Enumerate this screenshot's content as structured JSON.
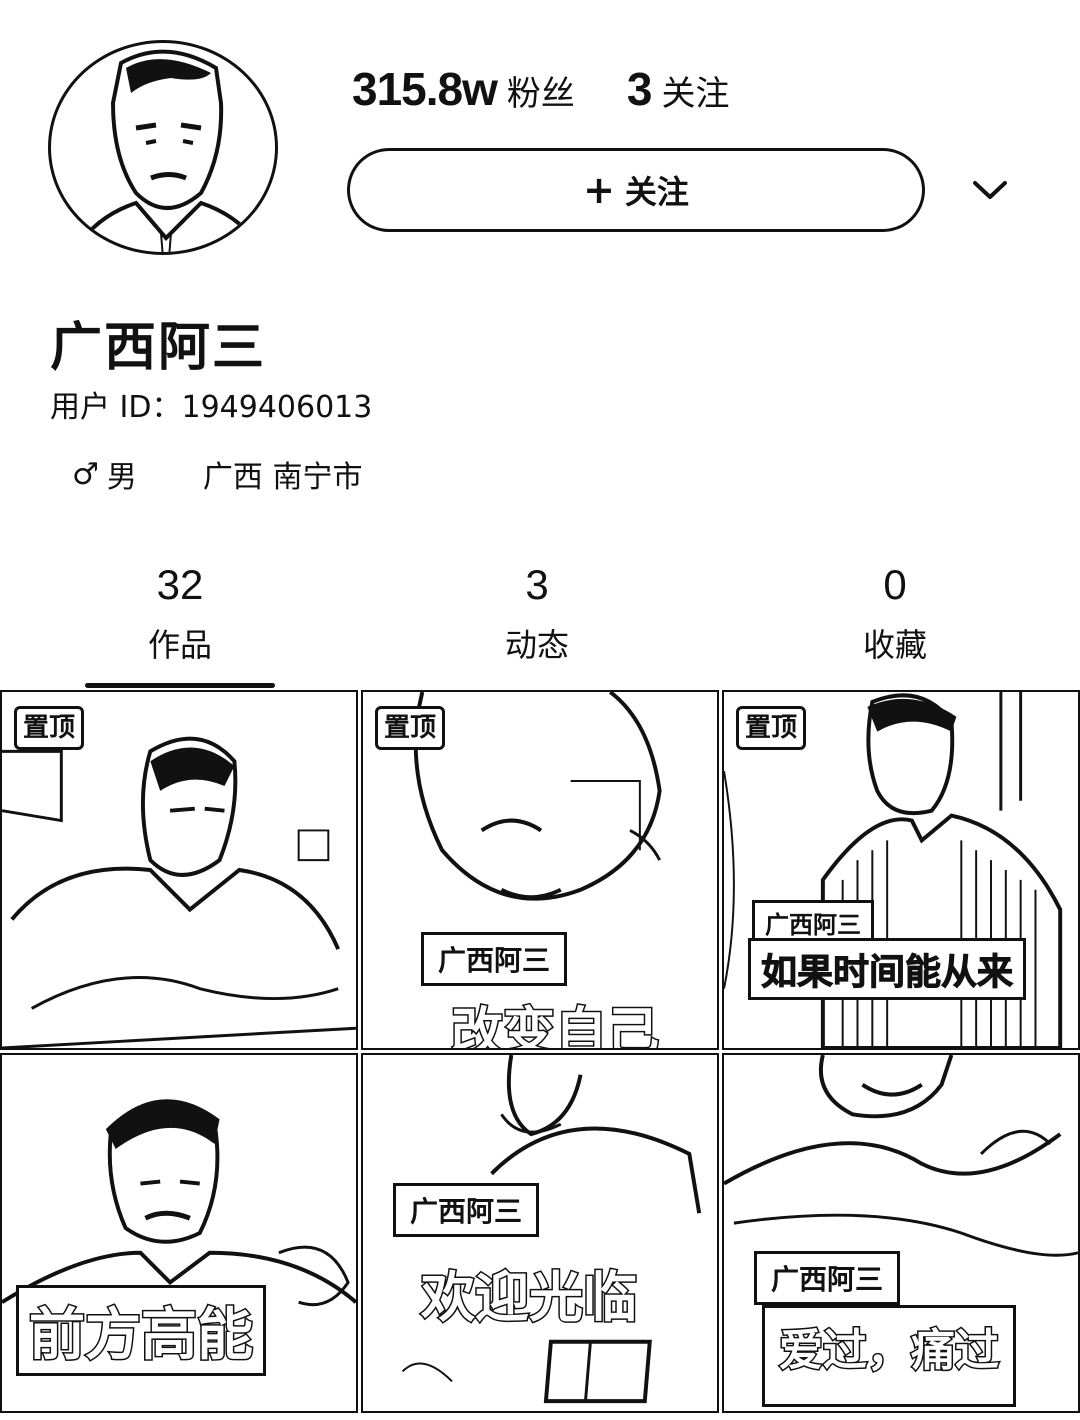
{
  "profile": {
    "followers_count": "315.8w",
    "followers_label": "粉丝",
    "following_count": "3",
    "following_label": "关注",
    "follow_button_label": "关注",
    "username": "广西阿三",
    "user_id": "用户 ID：1949406013",
    "gender": "男",
    "location": "广西 南宁市"
  },
  "tabs": [
    {
      "count": "32",
      "label": "作品"
    },
    {
      "count": "3",
      "label": "动态"
    },
    {
      "count": "0",
      "label": "收藏"
    }
  ],
  "videos": [
    {
      "pinned": "置顶",
      "tag": "",
      "caption": ""
    },
    {
      "pinned": "置顶",
      "tag": "广西阿三",
      "caption": "改变自己"
    },
    {
      "pinned": "置顶",
      "tag": "广西阿三",
      "caption": "如果时间能从来"
    },
    {
      "pinned": "",
      "tag": "",
      "caption": "前方高能"
    },
    {
      "pinned": "",
      "tag": "广西阿三",
      "caption": "欢迎光临"
    },
    {
      "pinned": "",
      "tag": "广西阿三",
      "caption": "爱过，痛过"
    }
  ],
  "colors": {
    "ink": "#111111",
    "background": "#ffffff"
  },
  "icons": {
    "follow": "plus-icon",
    "dropdown": "chevron-down-icon",
    "gender": "male-icon"
  }
}
